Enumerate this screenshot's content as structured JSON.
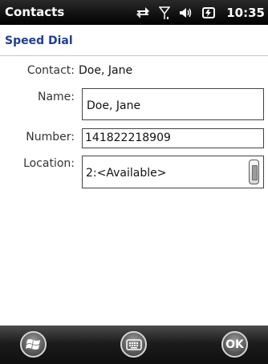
{
  "status_bar": {
    "app_title": "Contacts",
    "time": "10:35",
    "icons": [
      "data-connection-icon",
      "signal-icon",
      "volume-icon",
      "battery-icon"
    ]
  },
  "header": {
    "title": "Speed Dial"
  },
  "form": {
    "contact_label": "Contact:",
    "contact_value": "Doe, Jane",
    "name_label": "Name:",
    "name_value": "Doe, Jane",
    "number_label": "Number:",
    "number_value": "141822218909",
    "location_label": "Location:",
    "location_value": "2:<Available>"
  },
  "softkeys": {
    "left": "windows-start-icon",
    "middle": "keyboard-icon",
    "right_label": "OK"
  },
  "colors": {
    "title_blue": "#1f3f8f",
    "bar_black": "#000000"
  }
}
